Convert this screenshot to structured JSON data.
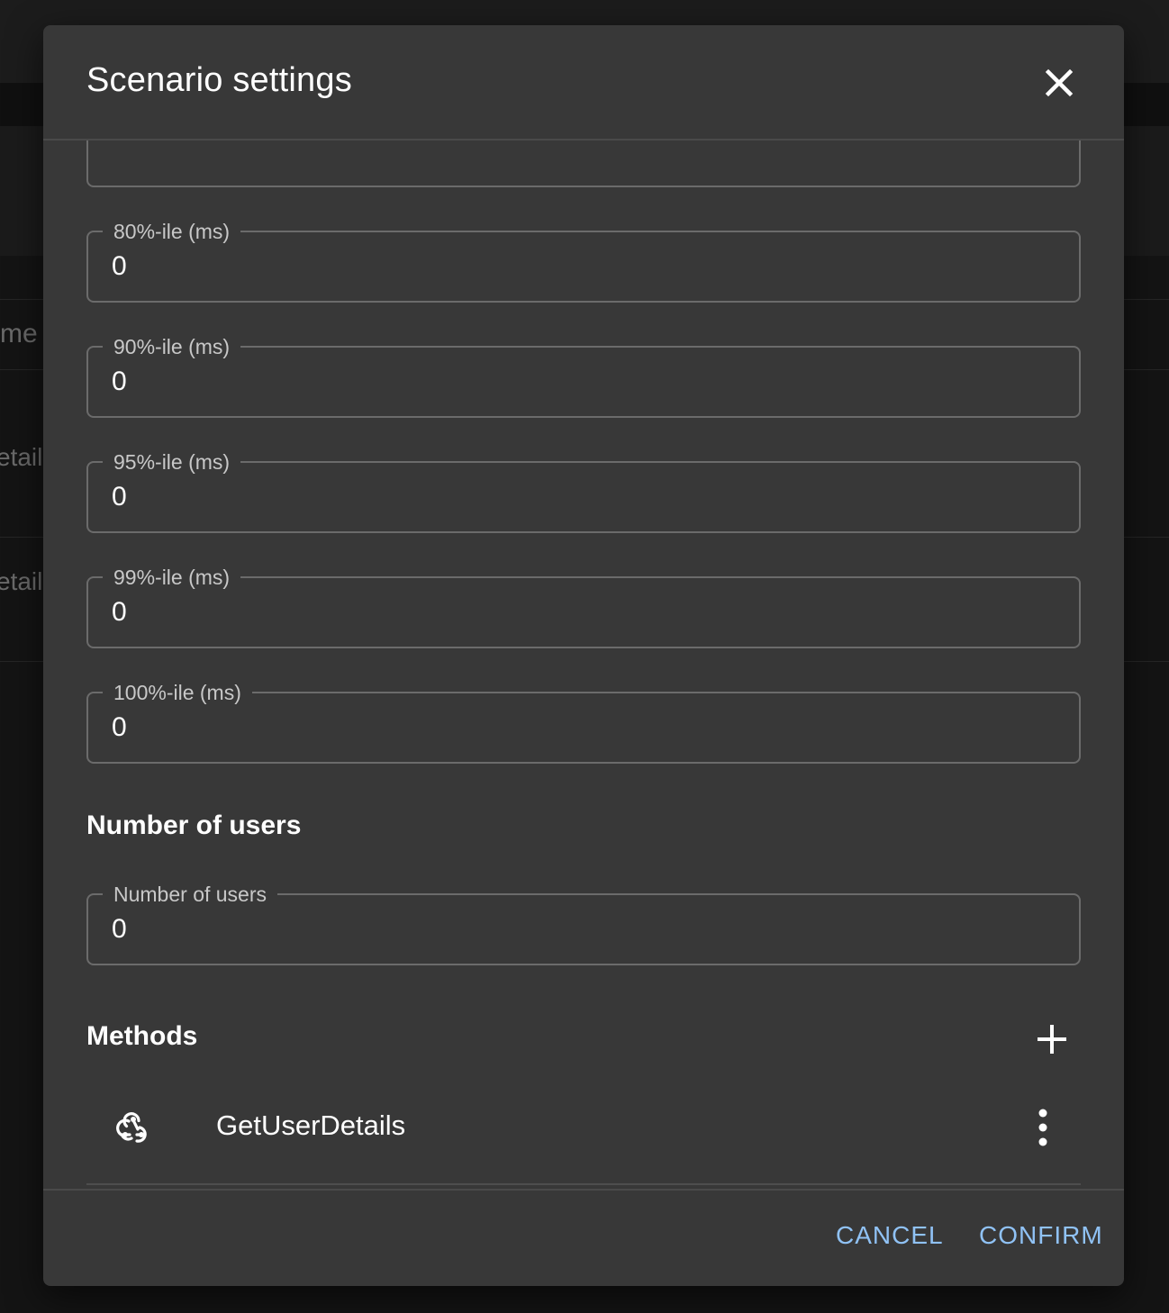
{
  "dialog": {
    "title": "Scenario settings",
    "close_icon": "close-icon"
  },
  "percentile_fields": [
    {
      "label": "80%-ile (ms)",
      "value": "0"
    },
    {
      "label": "90%-ile (ms)",
      "value": "0"
    },
    {
      "label": "95%-ile (ms)",
      "value": "0"
    },
    {
      "label": "99%-ile (ms)",
      "value": "0"
    },
    {
      "label": "100%-ile (ms)",
      "value": "0"
    }
  ],
  "users": {
    "section_title": "Number of users",
    "field_label": "Number of users",
    "field_value": "0"
  },
  "methods": {
    "section_title": "Methods",
    "add_icon": "plus-icon",
    "items": [
      {
        "name": "GetUserDetails",
        "icon": "webhook-icon",
        "menu_icon": "more-vert-icon"
      }
    ]
  },
  "actions": {
    "cancel": "CANCEL",
    "confirm": "CONFIRM"
  },
  "background": {
    "header_text": "me",
    "row1_text": "etail",
    "row2_text": "etail"
  },
  "colors": {
    "dialog_bg": "#383838",
    "accent": "#90c2f5",
    "backdrop": "#121212"
  }
}
